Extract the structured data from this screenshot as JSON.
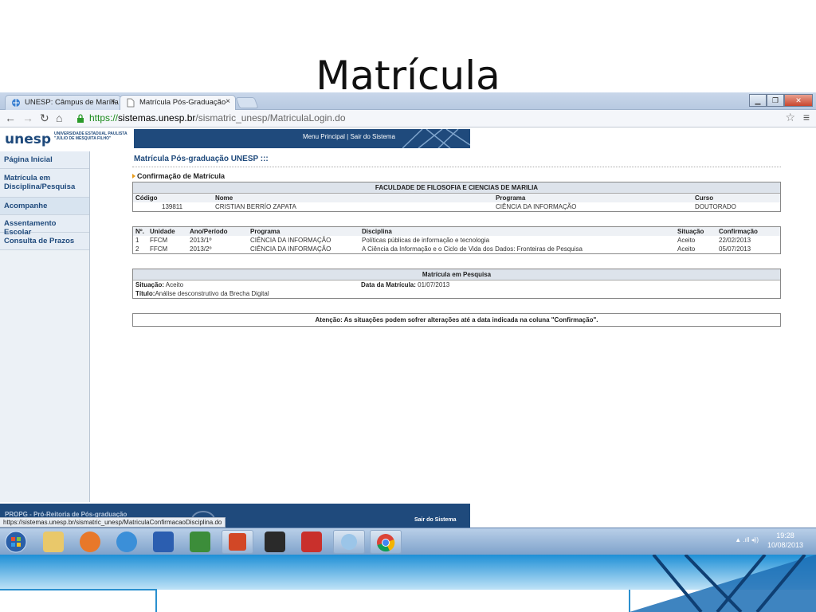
{
  "slide": {
    "title": "Matrícula"
  },
  "browser": {
    "tabs": [
      {
        "label": "UNESP: Câmpus de Marília"
      },
      {
        "label": "Matrícula Pós-Graduação"
      }
    ],
    "tab_close": "×",
    "url": {
      "scheme": "https://",
      "host": "sistemas.unesp.br",
      "path": "/sismatric_unesp/MatriculaLogin.do"
    },
    "status_url": "https://sistemas.unesp.br/sismatric_unesp/MatriculaConfirmacaoDisciplina.do"
  },
  "banner": {
    "logo": "unesp",
    "logo_sub_1": "UNIVERSIDADE ESTADUAL PAULISTA",
    "logo_sub_2": "\"JÚLIO DE MESQUITA FILHO\"",
    "links": "Menu Principal | Sair do Sistema"
  },
  "sidebar": {
    "items": [
      {
        "label": "Página Inicial"
      },
      {
        "label": "Matrícula em Disciplina/Pesquisa"
      },
      {
        "label": "Acompanhe"
      },
      {
        "label": "Assentamento Escolar"
      },
      {
        "label": "Consulta de Prazos"
      }
    ]
  },
  "content": {
    "page_title": "Matrícula Pós-graduação UNESP :::",
    "section_title": "Confirmação de Matrícula",
    "faculty": "FACULDADE DE FILOSOFIA E CIENCIAS DE MARILIA",
    "student_headers": {
      "codigo": "Código",
      "nome": "Nome",
      "programa": "Programa",
      "curso": "Curso"
    },
    "student": {
      "codigo": "139811",
      "nome": "CRISTIAN BERRÍO ZAPATA",
      "programa": "CIÊNCIA DA INFORMAÇÃO",
      "curso": "DOUTORADO"
    },
    "disc_headers": {
      "n": "Nº.",
      "unidade": "Unidade",
      "ano": "Ano/Período",
      "programa": "Programa",
      "disciplina": "Disciplina",
      "situacao": "Situação",
      "confirmacao": "Confirmação"
    },
    "disciplines": [
      {
        "n": "1",
        "unidade": "FFCM",
        "ano": "2013/1º",
        "programa": "CIÊNCIA DA INFORMAÇÃO",
        "disciplina": "Políticas públicas de informação e tecnologia",
        "situacao": "Aceito",
        "confirmacao": "22/02/2013"
      },
      {
        "n": "2",
        "unidade": "FFCM",
        "ano": "2013/2º",
        "programa": "CIÊNCIA DA INFORMAÇÃO",
        "disciplina": "A Ciência da Informação e o Ciclo de Vida dos Dados: Fronteiras de Pesquisa",
        "situacao": "Aceito",
        "confirmacao": "05/07/2013"
      }
    ],
    "research": {
      "title": "Matrícula em Pesquisa",
      "situacao_label": "Situação:",
      "situacao": "Aceito",
      "data_label": "Data da Matrícula:",
      "data": "01/07/2013",
      "titulo_label": "Título:",
      "titulo": "Análise desconstrutivo da Brecha Digital"
    },
    "notice": "Atenção: As situações podem sofrer alterações até a data indicada na coluna \"Confirmação\"."
  },
  "footer": {
    "left": "PROPG - Pró-Reitoria de Pós-graduação",
    "right": "Sair do Sistema"
  },
  "taskbar": {
    "time": "19:28",
    "date": "10/08/2013",
    "tray": "▲ .ıll ◂))"
  },
  "colors": {
    "brand": "#1f4a7c",
    "accent": "#e89c1a"
  }
}
